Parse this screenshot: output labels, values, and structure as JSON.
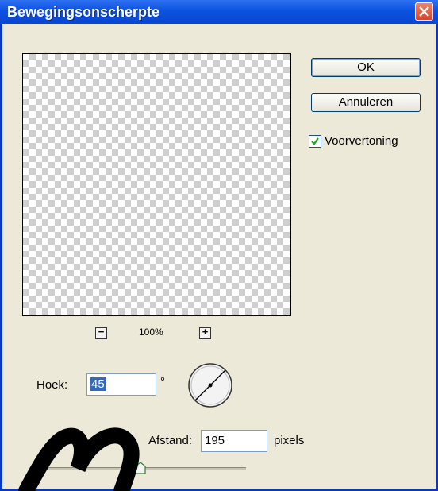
{
  "window": {
    "title": "Bewegingsonscherpte"
  },
  "buttons": {
    "ok": "OK",
    "cancel": "Annuleren"
  },
  "preview_option": {
    "label": "Voorvertoning",
    "checked": true
  },
  "zoom": {
    "level": "100%",
    "minus": "−",
    "plus": "+"
  },
  "angle": {
    "label": "Hoek:",
    "value": "45",
    "unit": "°"
  },
  "distance": {
    "label": "Afstand:",
    "value": "195",
    "unit": "pixels",
    "fraction": 0.5
  },
  "icons": [
    "close-icon",
    "check-icon",
    "minus-icon",
    "plus-icon",
    "angle-dial-icon",
    "slider-thumb-icon"
  ],
  "colors": {
    "titlebar": "#0a53e0",
    "dialog_bg": "#ece9d8",
    "selection": "#316ac5",
    "close": "#d1462a"
  }
}
